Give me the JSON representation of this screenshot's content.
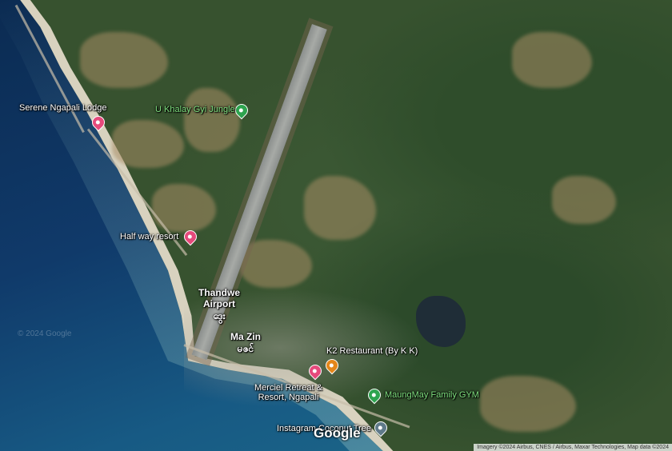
{
  "labels": {
    "serene": "Serene Ngapali Lodge",
    "khalay": "U Khalay Gyi Jungle",
    "halfway": "Half way resort",
    "airport_line1": "Thandwe",
    "airport_line2": "Airport",
    "airport_local": "ဒွေး",
    "mazin": "Ma Zin",
    "mazin_local": "မဇင်",
    "k2": "K2 Restaurant (By K K)",
    "merciel_line1": "Merciel Retreat &",
    "merciel_line2": "Resort, Ngapali",
    "gym": "MaungMay Family GYM",
    "instagram": "Instagram Coconut Tree"
  },
  "branding": {
    "logo": "Google",
    "watermark": "© 2024 Google"
  },
  "attribution": "Imagery ©2024 Airbus, CNES / Airbus, Maxar Technologies, Map data ©2024",
  "icons": {
    "serene": "hotel-pin-icon",
    "khalay": "park-pin-icon",
    "halfway": "hotel-pin-icon",
    "k2": "restaurant-pin-icon",
    "merciel": "hotel-pin-icon",
    "gym": "gym-pin-icon",
    "instagram": "landmark-pin-icon"
  },
  "colors": {
    "hotel": "#e64a7c",
    "restaurant": "#e4861a",
    "park": "#2ea44f"
  }
}
